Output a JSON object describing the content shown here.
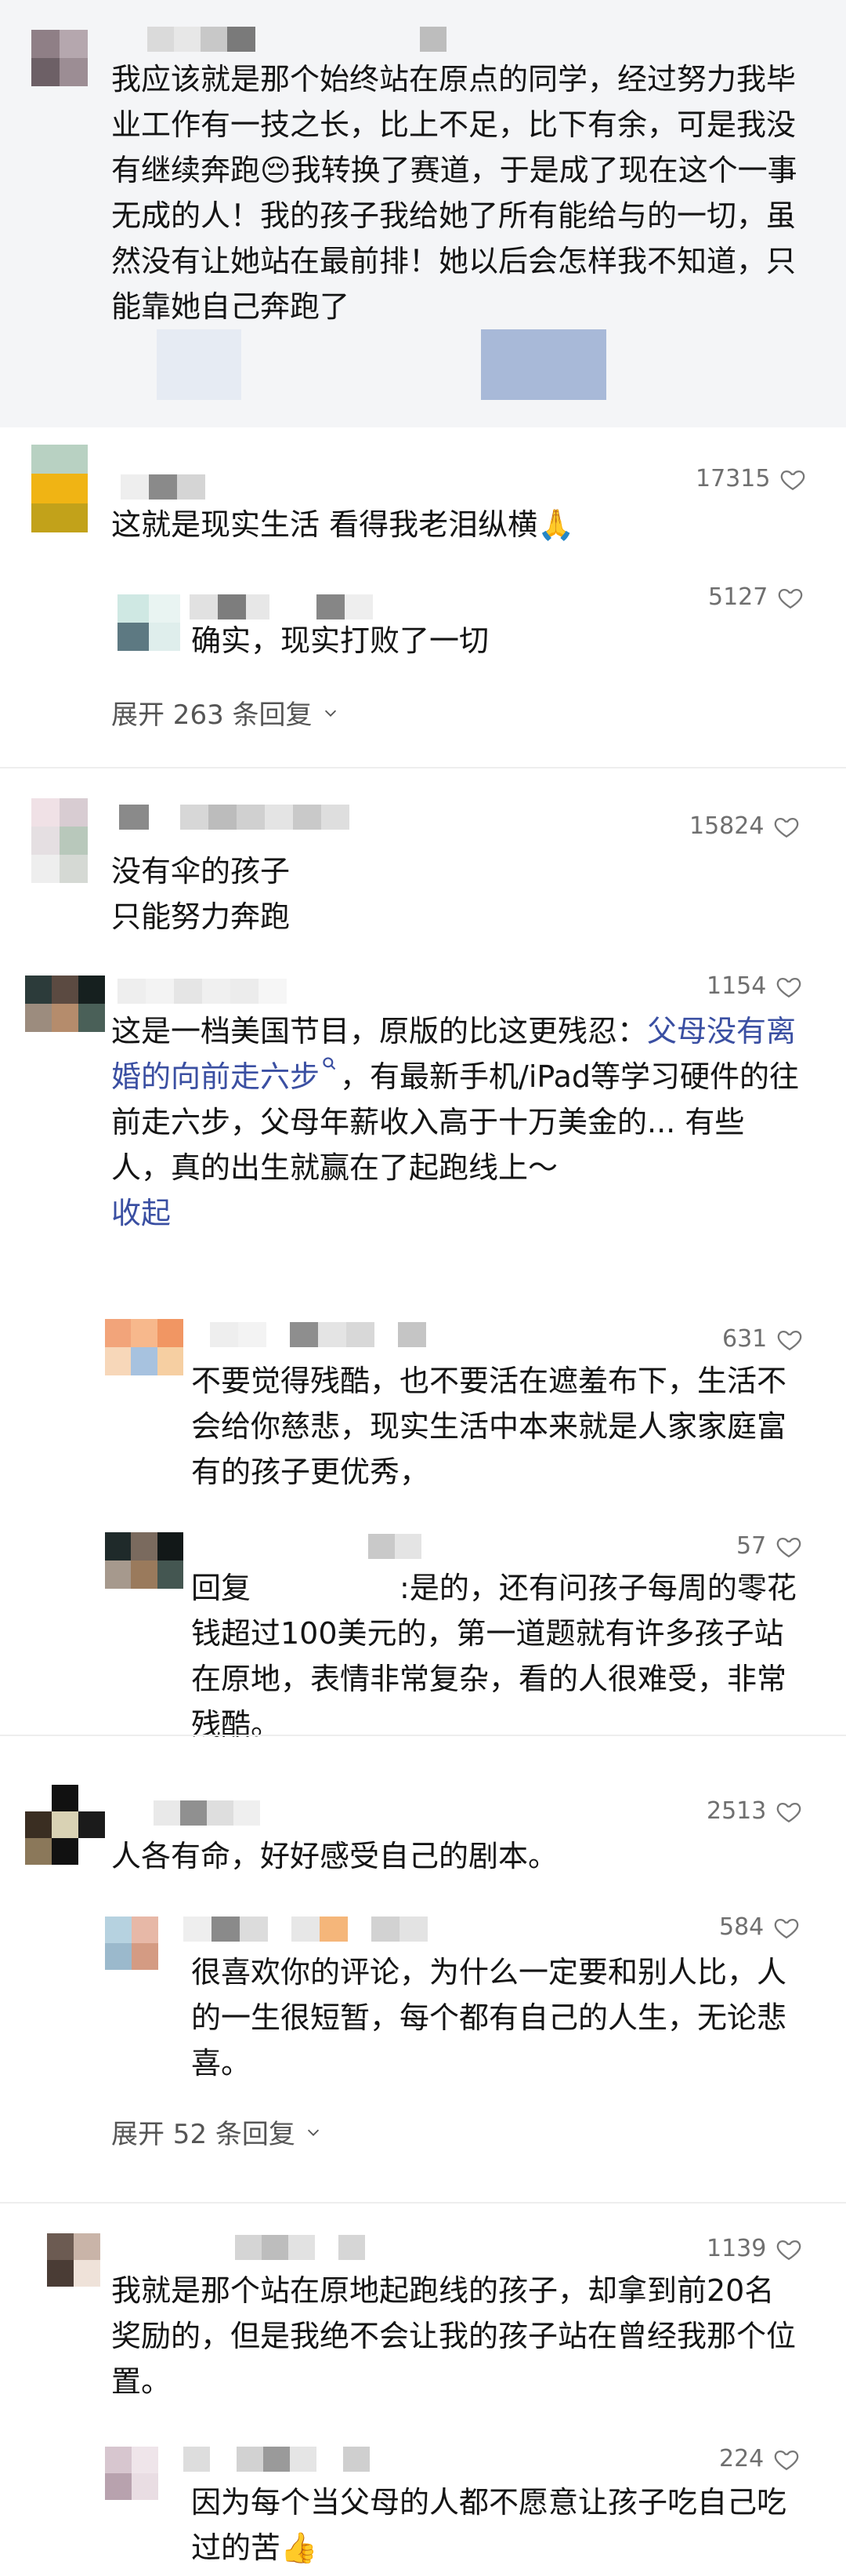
{
  "threads": [
    {
      "text": "我应该就是那个始终站在原点的同学，经过努力我毕业工作有一技之长，比上不足，比下有余，可是我没有继续奔跑😔我转换了赛道，于是成了现在这个一事无成的人！我的孩子我给她了所有能给与的一切，虽然没有让她站在最前排！她以后会怎样我不知道，只能靠她自己奔跑了"
    },
    {
      "text": "这就是现实生活 看得我老泪纵横🙏",
      "likes": "17315",
      "reply": {
        "text": "确实，现实打败了一切",
        "likes": "5127"
      },
      "expand": "展开 263 条回复"
    },
    {
      "text_line1": "没有伞的孩子",
      "text_line2": "只能努力奔跑",
      "likes": "15824"
    },
    {
      "text_before": "这是一档美国节目，原版的比这更残忍：",
      "link": "父母没有离婚的向前走六步",
      "text_after": "，有最新手机/iPad等学习硬件的往前走六步，父母年薪收入高于十万美金的... 有些人，真的出生就赢在了起跑线上～",
      "collapse": "收起",
      "likes": "1154",
      "replies": [
        {
          "text": "不要觉得残酷，也不要活在遮羞布下，生活不会给你慈悲，现实生活中本来就是人家家庭富有的孩子更优秀，",
          "likes": "631"
        },
        {
          "prefix": "回复",
          "text": ":是的，还有问孩子每周的零花钱超过100美元的，第一道题就有许多孩子站在原地，表情非常复杂，看的人很难受，非常残酷。",
          "likes": "57"
        }
      ]
    },
    {
      "text": "人各有命，好好感受自己的剧本。",
      "likes": "2513",
      "reply": {
        "text": "很喜欢你的评论，为什么一定要和别人比，人的一生很短暂，每个都有自己的人生，无论悲喜。",
        "likes": "584"
      },
      "expand": "展开 52 条回复"
    },
    {
      "text": "我就是那个站在原地起跑线的孩子，却拿到前20名奖励的，但是我绝不会让我的孩子站在曾经我那个位置。",
      "likes": "1139",
      "reply": {
        "text": "因为每个当父母的人都不愿意让孩子吃自己吃过的苦👍",
        "likes": "224"
      }
    }
  ]
}
